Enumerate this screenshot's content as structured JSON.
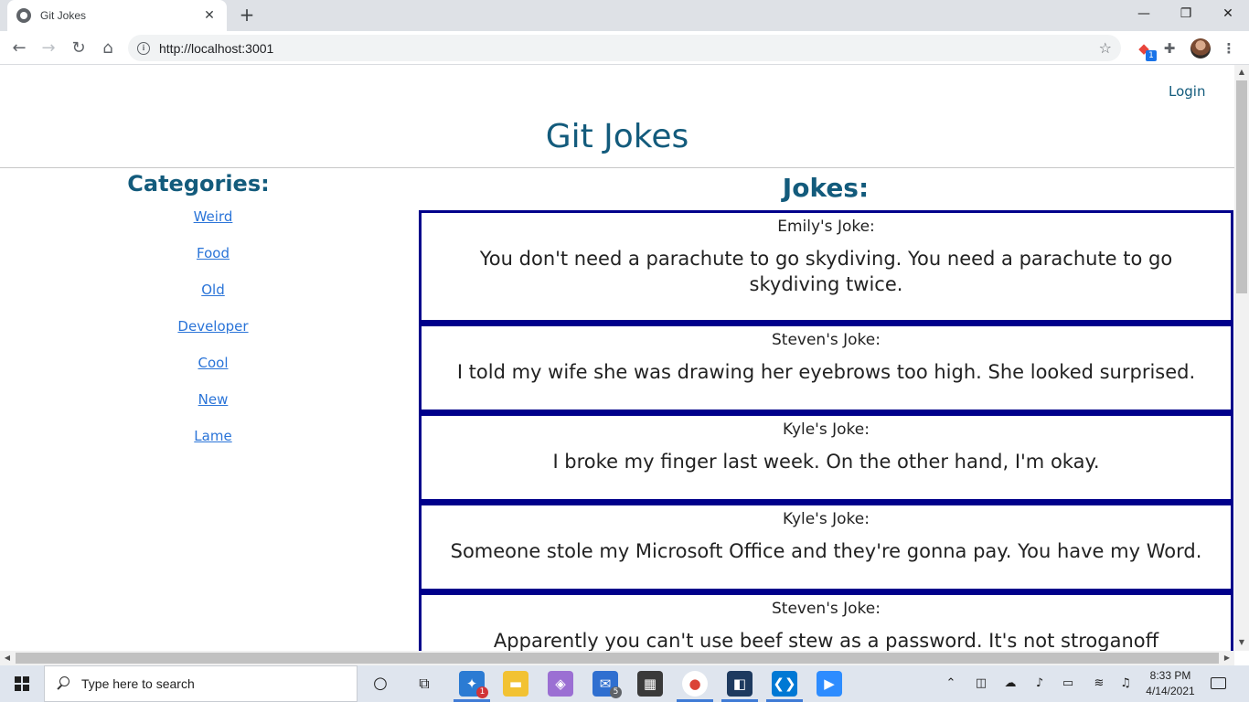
{
  "browser": {
    "tab_title": "Git Jokes",
    "tab_close": "✕",
    "new_tab": "+",
    "url": "http://localhost:3001",
    "minimize": "—",
    "restore": "❐",
    "close": "✕",
    "extension_badge": "1"
  },
  "site": {
    "login_label": "Login",
    "title": "Git Jokes"
  },
  "categories": {
    "heading": "Categories:",
    "items": [
      "Weird",
      "Food",
      "Old",
      "Developer",
      "Cool",
      "New",
      "Lame"
    ]
  },
  "jokes": {
    "heading": "Jokes:",
    "items": [
      {
        "author": "Emily's Joke:",
        "text": "You don't need a parachute to go skydiving. You need a parachute to go skydiving twice."
      },
      {
        "author": "Steven's Joke:",
        "text": "I told my wife she was drawing her eyebrows too high. She looked surprised."
      },
      {
        "author": "Kyle's Joke:",
        "text": "I broke my finger last week. On the other hand, I'm okay."
      },
      {
        "author": "Kyle's Joke:",
        "text": "Someone stole my Microsoft Office and they're gonna pay. You have my Word."
      },
      {
        "author": "Steven's Joke:",
        "text": "Apparently you can't use beef stew as a password. It's not stroganoff"
      }
    ]
  },
  "taskbar": {
    "search_placeholder": "Type here to search",
    "time": "8:33 PM",
    "date": "4/14/2021",
    "app_badge_red": "1",
    "app_badge_mail": "5"
  },
  "colors": {
    "title": "#135b7c",
    "link": "#2a74d8",
    "joke_border": "#00008b"
  }
}
